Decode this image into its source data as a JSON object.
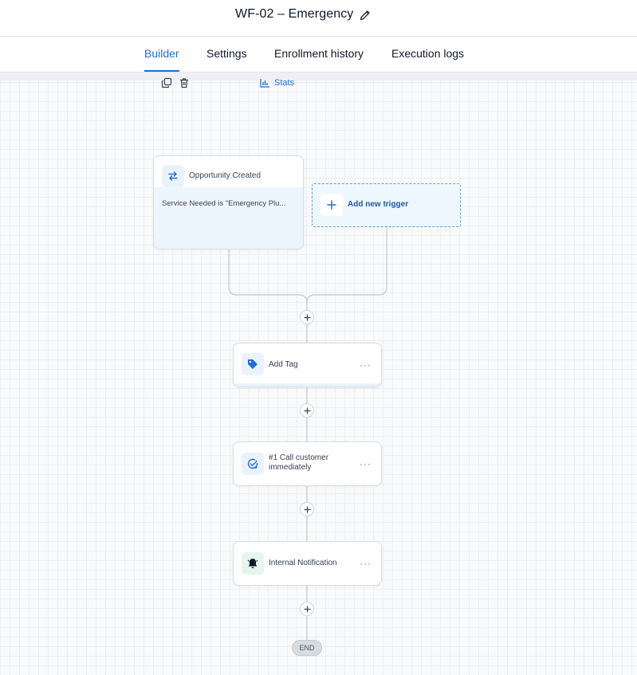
{
  "header": {
    "title": "WF-02 – Emergency"
  },
  "tabs": [
    {
      "label": "Builder",
      "active": true
    },
    {
      "label": "Settings",
      "active": false
    },
    {
      "label": "Enrollment history",
      "active": false
    },
    {
      "label": "Execution logs",
      "active": false
    }
  ],
  "trigger": {
    "title": "Opportunity Created",
    "condition": "Service Needed is \"Emergency Plu...",
    "stats_label": "Stats"
  },
  "add_trigger": {
    "label": "Add new trigger"
  },
  "actions": [
    {
      "label": "Add Tag",
      "icon": "tag-icon",
      "more": "···"
    },
    {
      "label_line1": "#1 Call customer",
      "label_line2": "immediately",
      "icon": "task-check-icon",
      "more": "···"
    },
    {
      "label": "Internal Notification",
      "icon": "bell-icon",
      "more": "···"
    }
  ],
  "end": {
    "label": "END"
  },
  "colors": {
    "accent": "#1d6fd6",
    "trigger_body": "#eef6fd",
    "connector": "#c5c9cf"
  }
}
